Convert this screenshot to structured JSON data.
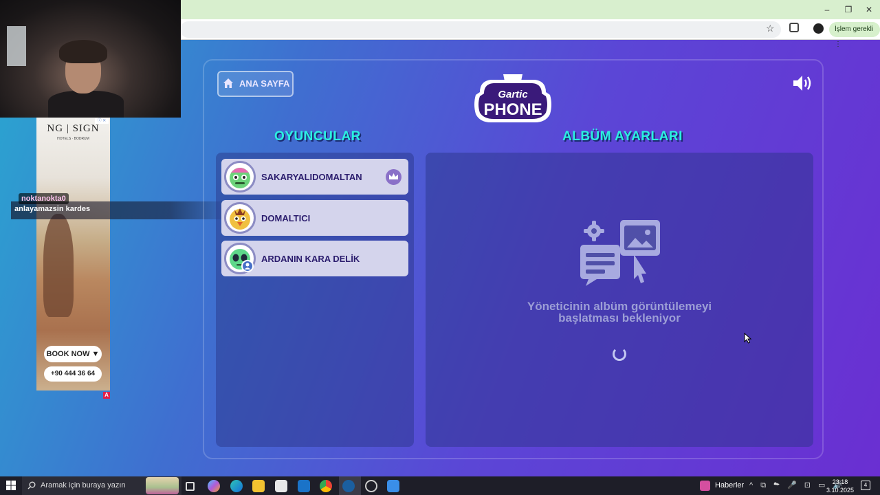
{
  "browser": {
    "action_pill": "İşlem gerekli ⋮",
    "window_buttons": [
      "–",
      "❐",
      "✕"
    ]
  },
  "stream_overlay": {
    "chat_username": "noktanokta0",
    "chat_message": "anlayamazsin kardes"
  },
  "ad": {
    "logo": "NG | SIGN",
    "logo_sub": "HOTELS · BODRUM",
    "book_label": "BOOK NOW ▼",
    "phone": "+90 444 36 64",
    "badge": "A",
    "info": "ⓘ ✕"
  },
  "game": {
    "home_button": "ANA SAYFA",
    "logo_top": "Gartic",
    "logo_bottom": "PHONE",
    "players_title": "OYUNCULAR",
    "album_title": "ALBÜM AYARLARI",
    "players": [
      {
        "name": "SAKARYALIDOMALTAN",
        "host": true
      },
      {
        "name": "DOMALTICI",
        "host": false
      },
      {
        "name": "ARDANIN KARA DELİK",
        "host": false
      }
    ],
    "waiting_message": "Yöneticinin albüm görüntülemeyi başlatması bekleniyor"
  },
  "taskbar": {
    "search_placeholder": "Aramak için buraya yazın",
    "news_label": "Haberler",
    "tray": "^ ⧉ ☁ 🎤 ⊡ ▭ 🔊",
    "time": "23:18",
    "date": "3.10.2025",
    "notification_count": "4"
  },
  "colors": {
    "accent_cyan": "#2bf0e0",
    "card_bg": "#d4d4ec",
    "title_bar": "#d8efce"
  }
}
